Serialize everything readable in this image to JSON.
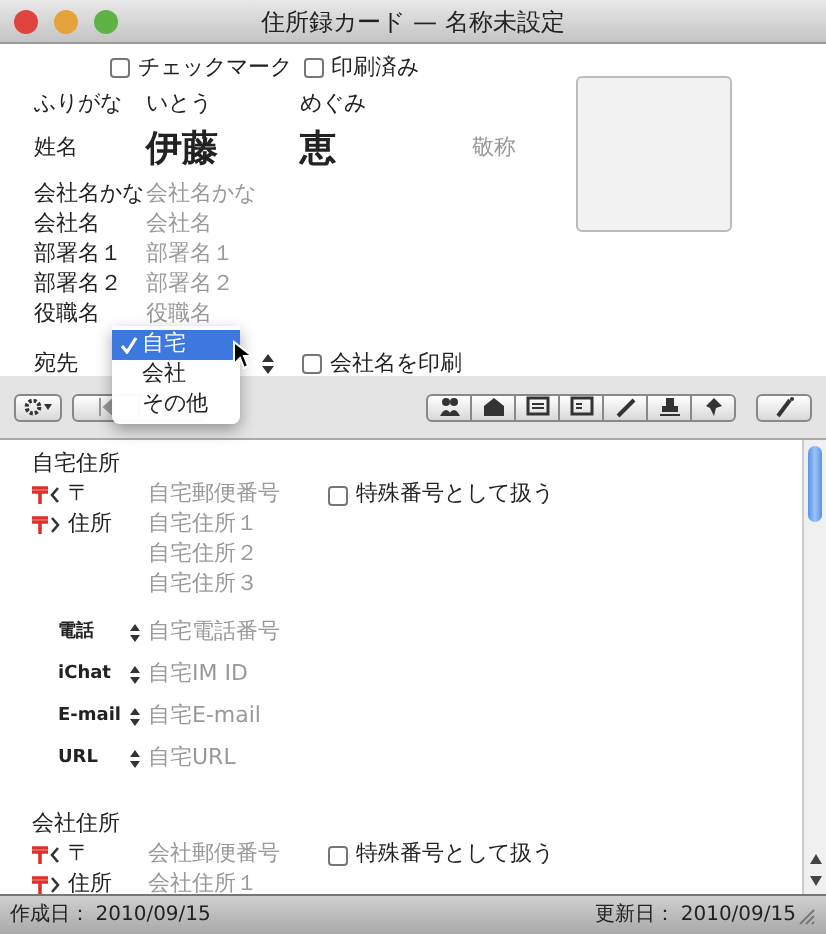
{
  "window": {
    "title": "住所録カード — 名称未設定"
  },
  "checkboxes": [
    {
      "label": "チェックマーク",
      "checked": false
    },
    {
      "label": "印刷済み",
      "checked": false
    }
  ],
  "furigana": {
    "label": "ふりがな",
    "last": "いとう",
    "first": "めぐみ"
  },
  "name": {
    "label": "姓名",
    "last": "伊藤",
    "first": "恵",
    "honorific_placeholder": "敬称"
  },
  "company_fields": [
    {
      "label": "会社名かな",
      "placeholder": "会社名かな"
    },
    {
      "label": "会社名",
      "placeholder": "会社名"
    },
    {
      "label": "部署名１",
      "placeholder": "部署名１"
    },
    {
      "label": "部署名２",
      "placeholder": "部署名２"
    },
    {
      "label": "役職名",
      "placeholder": "役職名"
    }
  ],
  "destination": {
    "label": "宛先",
    "menu_open": true,
    "options": [
      {
        "label": "自宅",
        "selected": true
      },
      {
        "label": "会社",
        "selected": false
      },
      {
        "label": "その他",
        "selected": false
      }
    ]
  },
  "print_company": {
    "label": "会社名を印刷",
    "checked": false
  },
  "home_address": {
    "title": "自宅住所",
    "postal_label": "〒",
    "postal_placeholder": "自宅郵便番号",
    "special": {
      "label": "特殊番号として扱う",
      "checked": false
    },
    "address_label": "住所",
    "address_placeholders": [
      "自宅住所１",
      "自宅住所２",
      "自宅住所３"
    ]
  },
  "contacts": [
    {
      "label": "電話",
      "placeholder": "自宅電話番号"
    },
    {
      "label": "iChat",
      "placeholder": "自宅IM ID"
    },
    {
      "label": "E-mail",
      "placeholder": "自宅E-mail"
    },
    {
      "label": "URL",
      "placeholder": "自宅URL"
    }
  ],
  "company_address": {
    "title": "会社住所",
    "postal_label": "〒",
    "postal_placeholder": "会社郵便番号",
    "special": {
      "label": "特殊番号として扱う",
      "checked": false
    },
    "address_label": "住所",
    "address_placeholders": [
      "会社住所１"
    ]
  },
  "status_bar": {
    "created_label": "作成日：",
    "created": "2010/09/15",
    "updated_label": "更新日：",
    "updated": "2010/09/15"
  }
}
